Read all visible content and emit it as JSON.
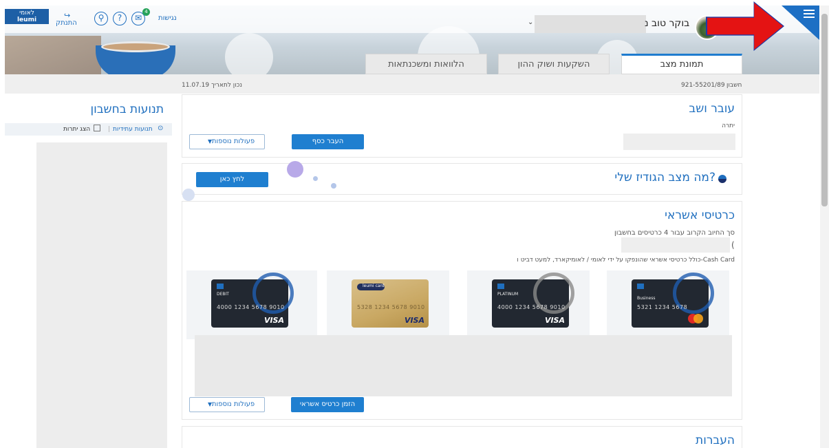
{
  "header": {
    "logo_he": "לאומי",
    "logo_en": "leumi",
    "logout_label": "התנתק",
    "accessibility_label": "נגישות",
    "messages_badge": "4",
    "greeting": "בוקר טוב נ"
  },
  "tabs": [
    {
      "label": "תמונת מצב",
      "active": true
    },
    {
      "label": "השקעות ושוק ההון",
      "active": false
    },
    {
      "label": "הלוואות ומשכנתאות",
      "active": false
    }
  ],
  "subheader": {
    "account_label": "חשבון",
    "account_number": "921-55201/89",
    "as_of": "נכון לתאריך 11.07.19"
  },
  "left_panel": {
    "title": "תנועות בחשבון",
    "option_future": "תנועות עתידיות",
    "option_balances": "הצג יתרות"
  },
  "checking": {
    "title": "עובר ושב",
    "balance_label": "יתרה",
    "transfer_button": "העבר כסף",
    "more_actions": "פעולות נוספות"
  },
  "savings": {
    "title": "מה מצב הגודיז שלי?",
    "click_here": "לחץ כאן"
  },
  "credit_cards": {
    "title": "כרטיסי אשראי",
    "next_charge": "סך החיוב הקרוב עבור 4 כרטיסים בחשבון",
    "paren": "(",
    "note": "כולל כרטיסי אשראי שהונפקו על ידי לאומי / לאומיקארד, למעט דביט ו-Cash Card",
    "cards": [
      {
        "label": "Business",
        "number": "5321 1234 5678",
        "network": "mastercard"
      },
      {
        "label": "PLATINUM",
        "number": "4000 1234 5678 9010",
        "network": "VISA"
      },
      {
        "label": "leumi card",
        "number": "5328 1234 5678 9010",
        "network": "VISA"
      },
      {
        "label": "DEBIT",
        "number": "4000 1234 5678 9010",
        "network": "VISA"
      }
    ],
    "order_button": "הזמן כרטיס אשראי",
    "more_actions": "פעולות נוספות"
  },
  "transfers": {
    "title": "העברות"
  },
  "colors": {
    "accent": "#1f7fd0",
    "arrow": "#e41313"
  }
}
